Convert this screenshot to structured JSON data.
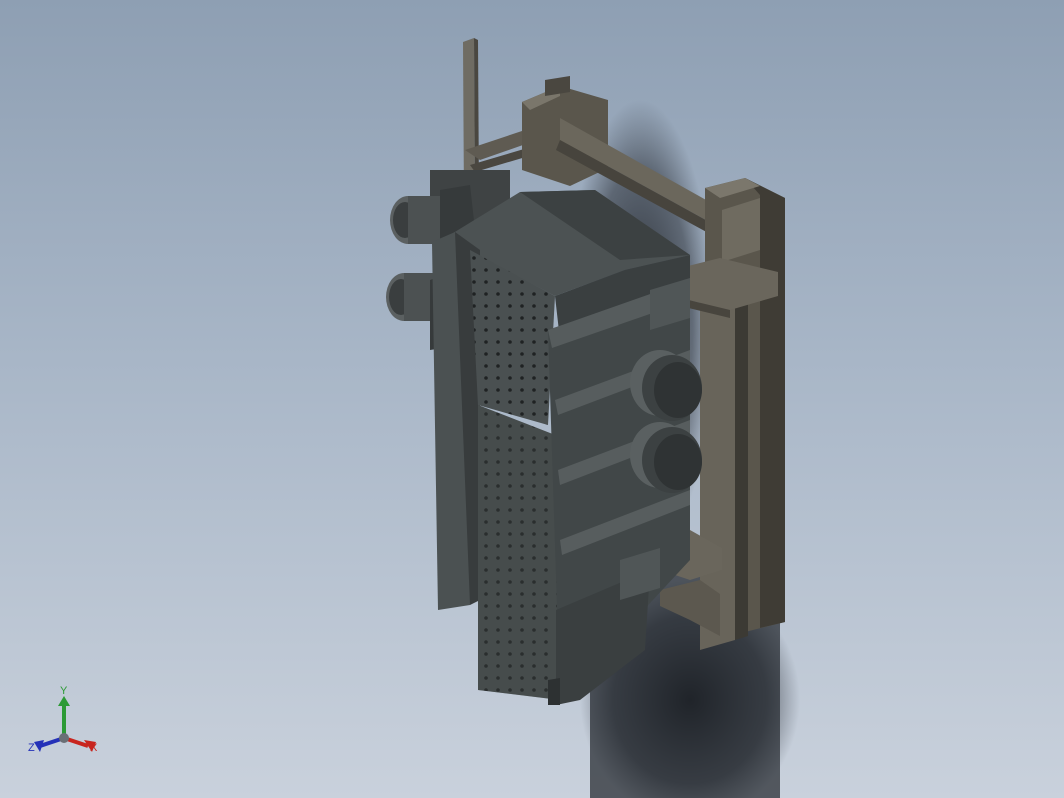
{
  "viewport": {
    "background_top": "#8e9fb3",
    "background_bottom": "#c9d1dc"
  },
  "model": {
    "colors": {
      "body_dark": "#3e4344",
      "body_mid": "#4f5556",
      "body_light": "#5f6566",
      "frame_dark": "#4a4740",
      "frame_light": "#6b675c",
      "frame_face": "#5a564c",
      "motor": "#55595a",
      "hole": "#1f2223"
    }
  },
  "triad": {
    "x_label": "X",
    "y_label": "Y",
    "z_label": "Z",
    "x_color": "#c8251e",
    "y_color": "#2c9a35",
    "z_color": "#2431b8"
  }
}
